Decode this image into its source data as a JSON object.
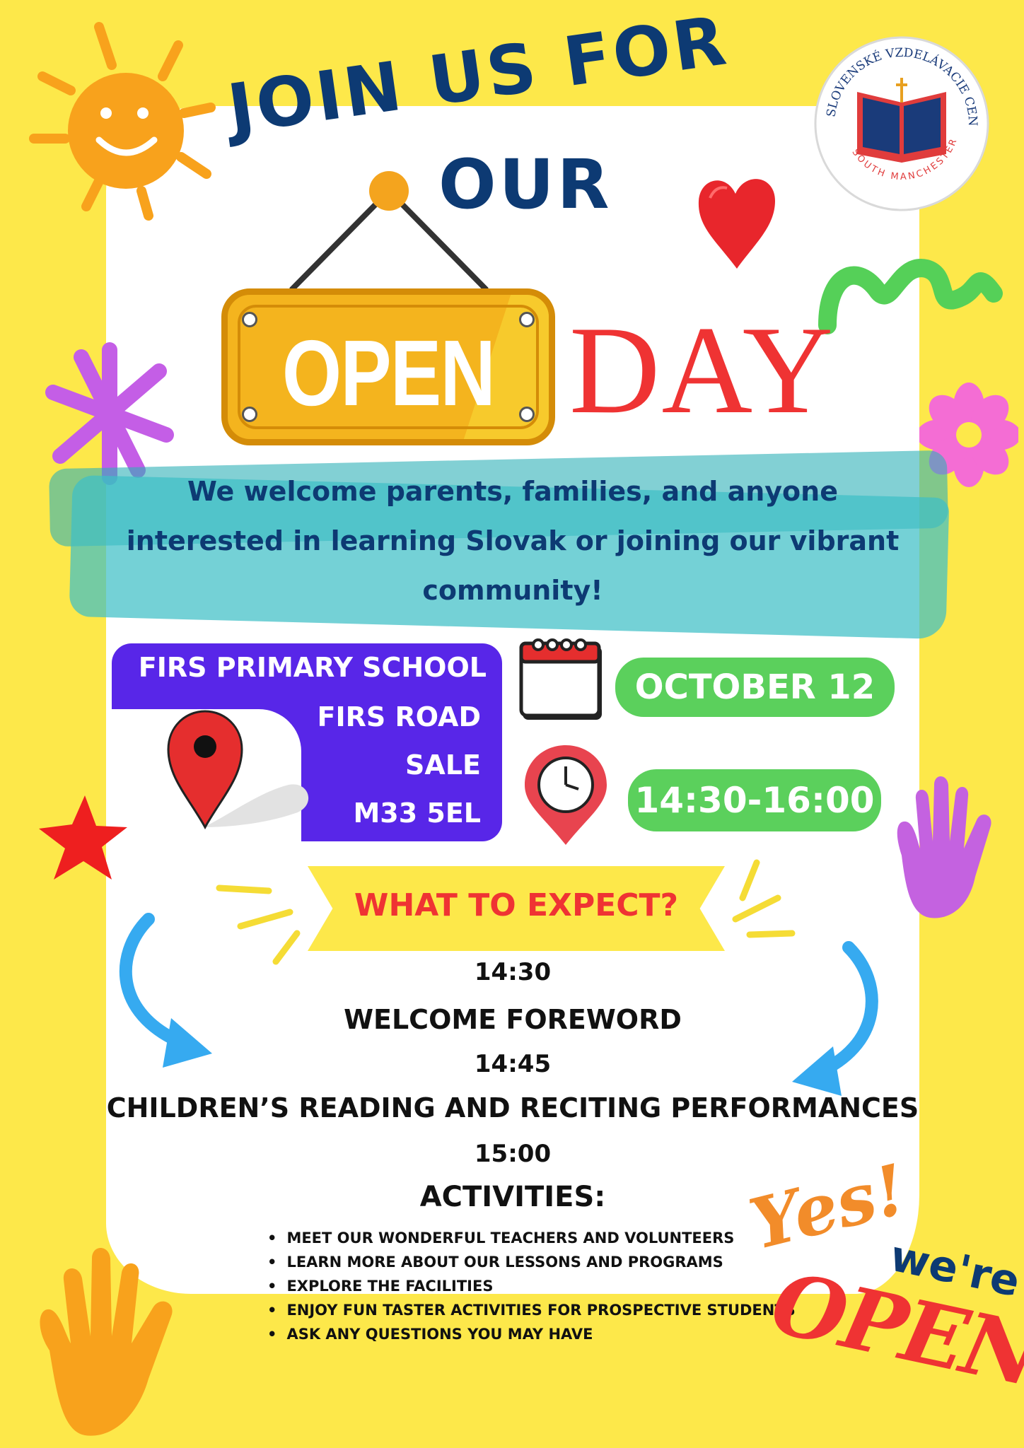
{
  "header": {
    "line1": "JOIN US FOR",
    "line2": "OUR"
  },
  "sign": {
    "open": "OPEN",
    "day": "DAY"
  },
  "intro": {
    "line1": "We welcome parents, families, and anyone",
    "line2": "interested in learning Slovak or joining our vibrant",
    "line3": "community!"
  },
  "address": {
    "line1": "FIRS PRIMARY SCHOOL",
    "line2": "FIRS ROAD",
    "line3": "SALE",
    "line4": "M33 5EL"
  },
  "date": "OCTOBER 12",
  "time": "14:30-16:00",
  "what_heading": "WHAT TO EXPECT?",
  "schedule": {
    "t1": "14:30",
    "e1": "WELCOME FOREWORD",
    "t2": "14:45",
    "e2": "CHILDREN’S READING AND RECITING PERFORMANCES",
    "t3": "15:00",
    "e3": "ACTIVITIES:"
  },
  "activities": [
    "MEET OUR WONDERFUL TEACHERS AND VOLUNTEERS",
    "LEARN MORE ABOUT OUR LESSONS AND PROGRAMS",
    "EXPLORE THE FACILITIES",
    "ENJOY FUN TASTER ACTIVITIES FOR PROSPECTIVE STUDENTS",
    "ASK ANY QUESTIONS YOU MAY HAVE"
  ],
  "logo": {
    "top_text": "SLOVENSKÉ VZDELÁVACIE CENTRUM",
    "bottom_text": "SOUTH MANCHESTER"
  },
  "stamp": {
    "yes": "Yes!",
    "were": "we're",
    "open": "OPEN"
  },
  "colors": {
    "background": "#fde84a",
    "navy": "#0d3a73",
    "red": "#ef3333",
    "purple": "#5826e8",
    "green": "#5bd05c",
    "teal": "#3fbfc6"
  },
  "icons": [
    "sun-icon",
    "heart-icon",
    "squiggle-icon",
    "star-burst-icon",
    "flower-icon",
    "map-pin-icon",
    "calendar-icon",
    "clock-pin-icon",
    "star-icon",
    "hand-icon",
    "arrow-icon"
  ]
}
